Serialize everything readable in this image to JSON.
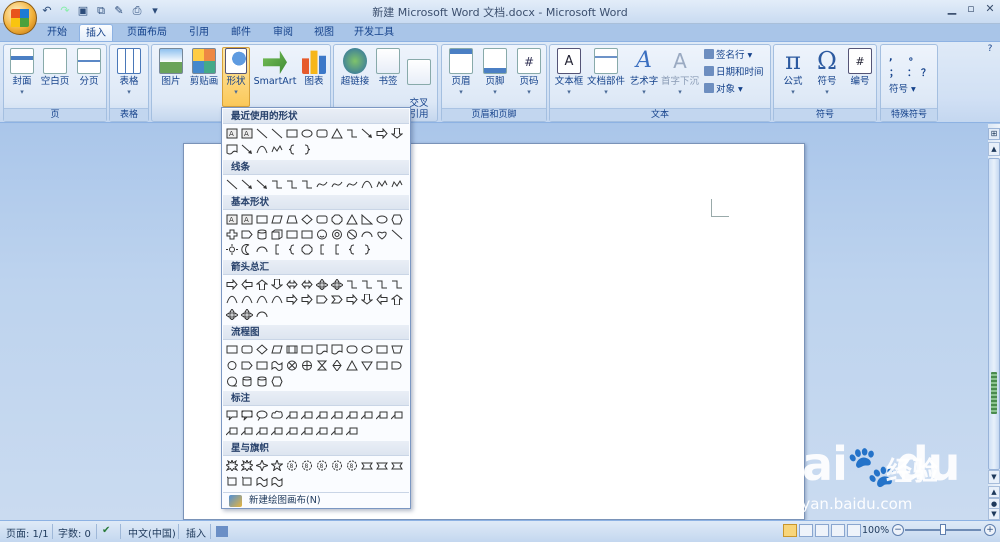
{
  "window": {
    "title": "新建 Microsoft Word 文档.docx - Microsoft Word",
    "controls": {
      "minimize": "▁",
      "restore": "▫",
      "close": "✕"
    }
  },
  "quick_access": [
    "save-icon",
    "undo-icon",
    "redo-icon",
    "print-preview-icon",
    "print-icon",
    "customize-icon"
  ],
  "tabs": [
    "开始",
    "插入",
    "页面布局",
    "引用",
    "邮件",
    "审阅",
    "视图",
    "开发工具"
  ],
  "active_tab": "插入",
  "ribbon": {
    "groups": {
      "pages": {
        "label": "页",
        "buttons": [
          "封面",
          "空白页",
          "分页"
        ]
      },
      "tables": {
        "label": "表格",
        "buttons": [
          "表格"
        ]
      },
      "illustrations": {
        "buttons": [
          "图片",
          "剪贴画",
          "形状",
          "SmartArt",
          "图表"
        ]
      },
      "links": {
        "buttons": [
          "超链接",
          "书签",
          "交叉\n引用"
        ]
      },
      "header_footer": {
        "label": "页眉和页脚",
        "buttons": [
          "页眉",
          "页脚",
          "页码"
        ]
      },
      "text": {
        "label": "文本",
        "buttons": [
          "文本框",
          "文档部件",
          "艺术字",
          "首字下沉"
        ],
        "small": [
          "签名行 ▾",
          "日期和时间",
          "对象 ▾"
        ]
      },
      "symbols": {
        "label": "符号",
        "buttons": [
          "公式",
          "符号",
          "编号"
        ]
      },
      "special": {
        "label": "特殊符号",
        "chars": [
          ",",
          "。",
          "；",
          "：",
          "？"
        ],
        "button": "符号 ▾"
      }
    }
  },
  "shapes_menu": {
    "sections": [
      "最近使用的形状",
      "线条",
      "基本形状",
      "箭头总汇",
      "流程图",
      "标注",
      "星与旗帜"
    ],
    "footer": "新建绘图画布(N)"
  },
  "status_bar": {
    "page": "页面: 1/1",
    "words": "字数: 0",
    "language": "中文(中国)",
    "insert_mode": "插入",
    "zoom": "100%"
  },
  "watermark": {
    "brand": "Bai",
    "brand2": "du",
    "product": "经验",
    "url": "jingyan.baidu.com"
  },
  "colors": {
    "accent": "#fbc95a",
    "ribbon": "#dfeaf7",
    "frame": "#8db2e3"
  }
}
